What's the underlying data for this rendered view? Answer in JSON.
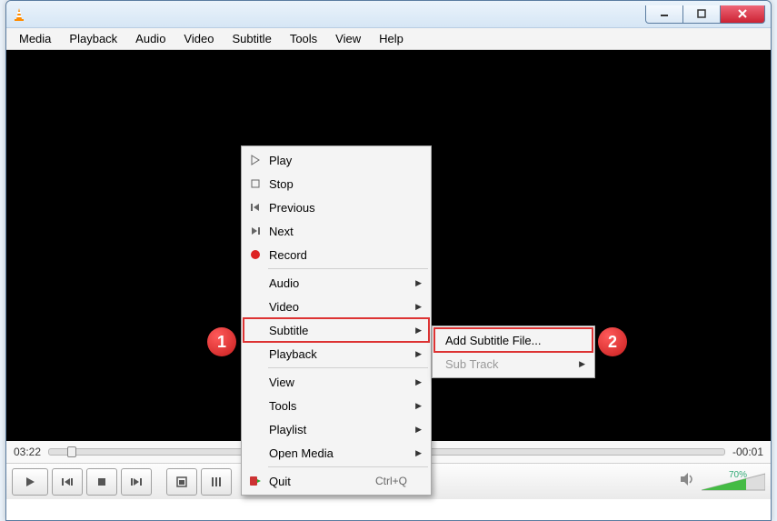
{
  "menubar": [
    "Media",
    "Playback",
    "Audio",
    "Video",
    "Subtitle",
    "Tools",
    "View",
    "Help"
  ],
  "seek": {
    "elapsed": "03:22",
    "remaining": "-00:01"
  },
  "volume": {
    "percent_label": "70%",
    "percent": 70
  },
  "context_menu": {
    "items": [
      {
        "label": "Play",
        "icon": "play-icon"
      },
      {
        "label": "Stop",
        "icon": "stop-icon"
      },
      {
        "label": "Previous",
        "icon": "previous-icon"
      },
      {
        "label": "Next",
        "icon": "next-icon"
      },
      {
        "label": "Record",
        "icon": "record-icon"
      }
    ],
    "submenus": [
      {
        "label": "Audio"
      },
      {
        "label": "Video"
      },
      {
        "label": "Subtitle",
        "highlight": true
      },
      {
        "label": "Playback"
      }
    ],
    "submenus2": [
      {
        "label": "View"
      },
      {
        "label": "Tools"
      },
      {
        "label": "Playlist"
      },
      {
        "label": "Open Media"
      }
    ],
    "quit": {
      "label": "Quit",
      "shortcut": "Ctrl+Q",
      "icon": "quit-icon"
    }
  },
  "subtitle_submenu": {
    "add_label": "Add Subtitle File...",
    "track_label": "Sub Track"
  },
  "annotations": {
    "badge1": "1",
    "badge2": "2"
  }
}
